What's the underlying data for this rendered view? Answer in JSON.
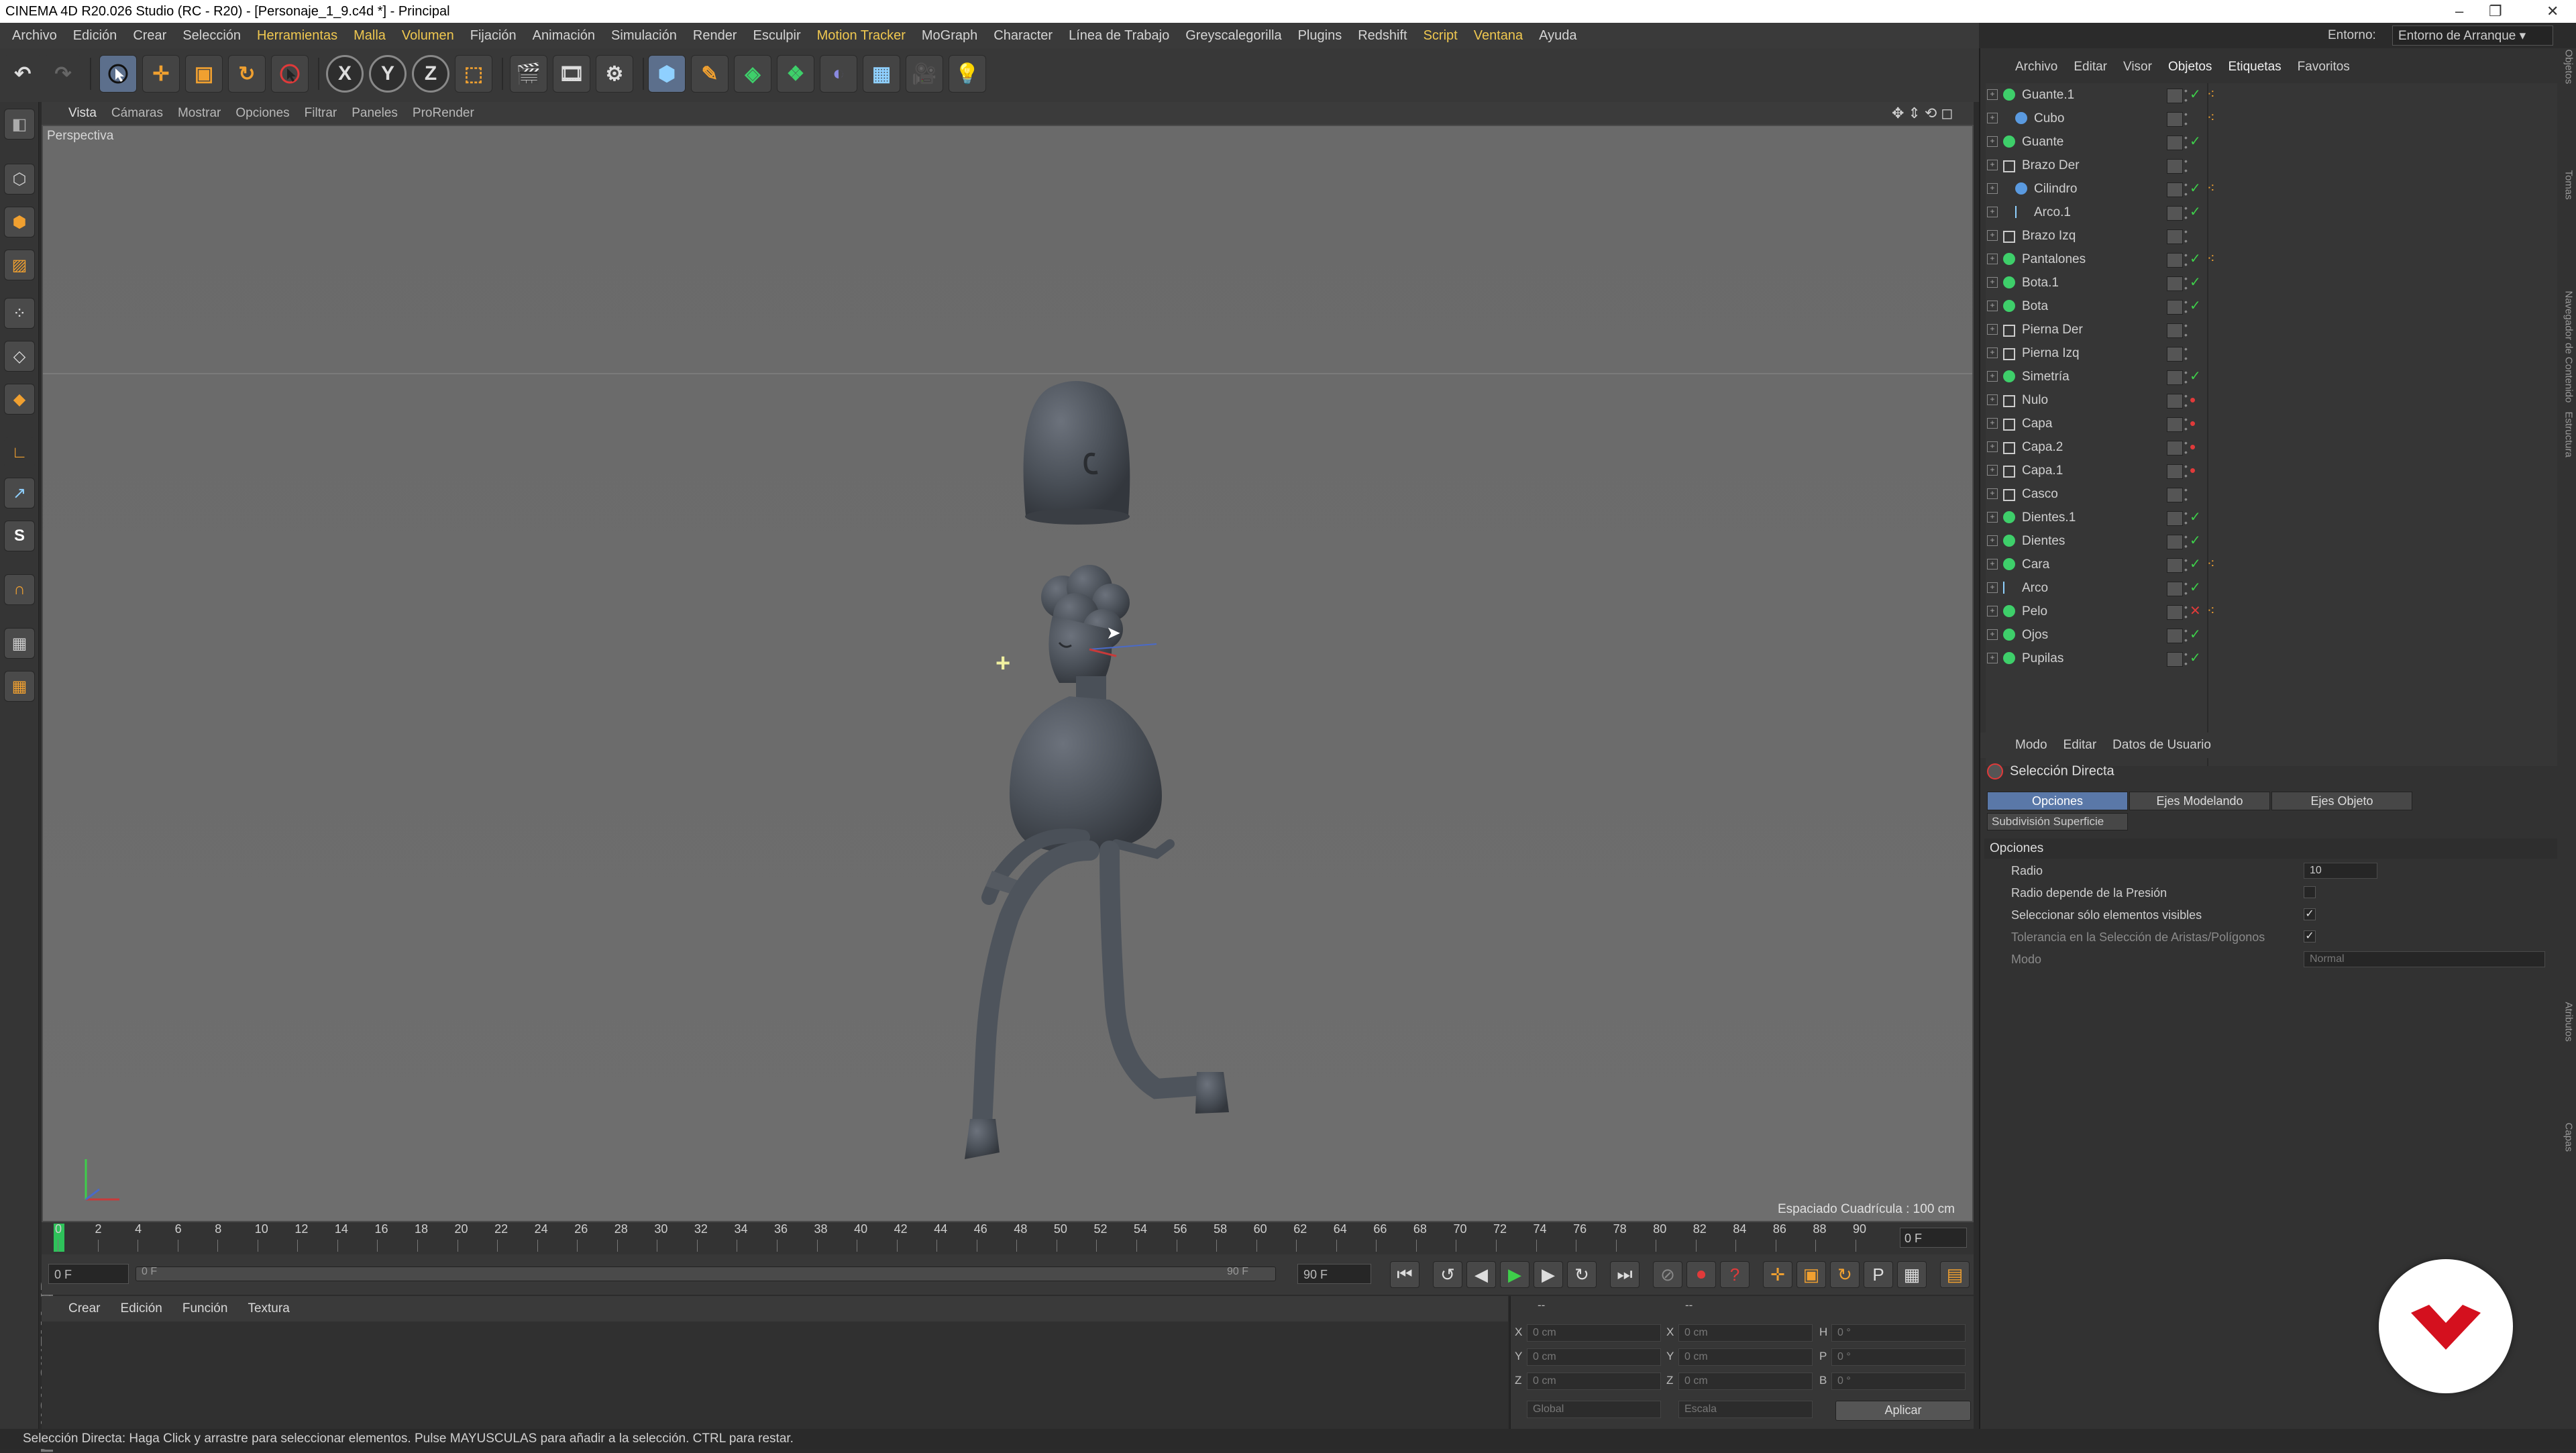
{
  "window": {
    "title": "CINEMA 4D R20.026 Studio (RC - R20) - [Personaje_1_9.c4d *] - Principal",
    "controls": [
      "–",
      "❐",
      "✕"
    ]
  },
  "menu": {
    "items": [
      "Archivo",
      "Edición",
      "Crear",
      "Selección",
      "Herramientas",
      "Malla",
      "Volumen",
      "Fijación",
      "Animación",
      "Simulación",
      "Render",
      "Esculpir",
      "Motion Tracker",
      "MoGraph",
      "Character",
      "Línea de Trabajo",
      "Greyscalegorilla",
      "Plugins",
      "Redshift",
      "Script",
      "Ventana",
      "Ayuda"
    ],
    "highlighted": [
      "Herramientas",
      "Malla",
      "Volumen",
      "Motion Tracker",
      "Script",
      "Ventana"
    ],
    "environment_label": "Entorno:",
    "environment_value": "Entorno de Arranque"
  },
  "viewport": {
    "menu": [
      "Vista",
      "Cámaras",
      "Mostrar",
      "Opciones",
      "Filtrar",
      "Paneles",
      "ProRender"
    ],
    "label": "Perspectiva",
    "grid_spacing": "Espaciado Cuadrícula : 100 cm"
  },
  "timeline": {
    "ticks": [
      "0",
      "2",
      "4",
      "6",
      "8",
      "10",
      "12",
      "14",
      "16",
      "18",
      "20",
      "22",
      "24",
      "26",
      "28",
      "30",
      "32",
      "34",
      "36",
      "38",
      "40",
      "42",
      "44",
      "46",
      "48",
      "50",
      "52",
      "54",
      "56",
      "58",
      "60",
      "62",
      "64",
      "66",
      "68",
      "70",
      "72",
      "74",
      "76",
      "78",
      "80",
      "82",
      "84",
      "86",
      "88",
      "90"
    ],
    "current_frame": "0 F",
    "end_frame": "0 F",
    "start_field": "0 F",
    "range_start": "0 F",
    "range_end": "90 F",
    "end_field": "90 F"
  },
  "material": {
    "menu": [
      "Crear",
      "Edición",
      "Función",
      "Textura"
    ]
  },
  "coords": {
    "header_left": "--",
    "header_mid": "--",
    "rows": [
      {
        "axis": "X",
        "pos": "0 cm",
        "size_axis": "X",
        "size": "0 cm",
        "rot_axis": "H",
        "rot": "0 °"
      },
      {
        "axis": "Y",
        "pos": "0 cm",
        "size_axis": "Y",
        "size": "0 cm",
        "rot_axis": "P",
        "rot": "0 °"
      },
      {
        "axis": "Z",
        "pos": "0 cm",
        "size_axis": "Z",
        "size": "0 cm",
        "rot_axis": "B",
        "rot": "0 °"
      }
    ],
    "mode1": "Global",
    "mode2": "Escala",
    "apply": "Aplicar"
  },
  "status": "Selección Directa: Haga Click y arrastre para seleccionar elementos. Pulse MAYUSCULAS para añadir a la selección. CTRL para restar.",
  "objects": {
    "menu": [
      "Archivo",
      "Editar",
      "Visor",
      "Objetos",
      "Etiquetas",
      "Favoritos"
    ],
    "items": [
      {
        "name": "Guante.1",
        "indent": 0,
        "icon": "#3ecf6a",
        "check": "green",
        "tag": true
      },
      {
        "name": "Cubo",
        "indent": 1,
        "icon": "#5a9ae0",
        "check": "none",
        "tag": true
      },
      {
        "name": "Guante",
        "indent": 0,
        "icon": "#3ecf6a",
        "check": "green",
        "tag": false
      },
      {
        "name": "Brazo Der",
        "indent": 0,
        "icon": "null",
        "check": "none",
        "tag": false
      },
      {
        "name": "Cilindro",
        "indent": 1,
        "icon": "#5a9ae0",
        "check": "green",
        "tag": true
      },
      {
        "name": "Arco.1",
        "indent": 1,
        "icon": "spline",
        "check": "green",
        "tag": false
      },
      {
        "name": "Brazo Izq",
        "indent": 0,
        "icon": "null",
        "check": "none",
        "tag": false
      },
      {
        "name": "Pantalones",
        "indent": 0,
        "icon": "#3ecf6a",
        "check": "green",
        "tag": true
      },
      {
        "name": "Bota.1",
        "indent": 0,
        "icon": "#3ecf6a",
        "check": "green",
        "tag": false
      },
      {
        "name": "Bota",
        "indent": 0,
        "icon": "#3ecf6a",
        "check": "green",
        "tag": false
      },
      {
        "name": "Pierna Der",
        "indent": 0,
        "icon": "null",
        "check": "none",
        "tag": false
      },
      {
        "name": "Pierna Izq",
        "indent": 0,
        "icon": "null",
        "check": "none",
        "tag": false
      },
      {
        "name": "Simetría",
        "indent": 0,
        "icon": "#3ecf6a",
        "check": "green",
        "tag": false
      },
      {
        "name": "Nulo",
        "indent": 0,
        "icon": "null",
        "check": "red-dot",
        "tag": false
      },
      {
        "name": "Capa",
        "indent": 0,
        "icon": "null",
        "check": "red-dot",
        "tag": false
      },
      {
        "name": "Capa.2",
        "indent": 0,
        "icon": "null",
        "check": "red-dot",
        "tag": false
      },
      {
        "name": "Capa.1",
        "indent": 0,
        "icon": "null",
        "check": "red-dot",
        "tag": false
      },
      {
        "name": "Casco",
        "indent": 0,
        "icon": "null",
        "check": "none",
        "tag": false
      },
      {
        "name": "Dientes.1",
        "indent": 0,
        "icon": "#3ecf6a",
        "check": "green",
        "tag": false
      },
      {
        "name": "Dientes",
        "indent": 0,
        "icon": "#3ecf6a",
        "check": "green",
        "tag": false
      },
      {
        "name": "Cara",
        "indent": 0,
        "icon": "#3ecf6a",
        "check": "green",
        "tag": true
      },
      {
        "name": "Arco",
        "indent": 0,
        "icon": "spline",
        "check": "green",
        "tag": false
      },
      {
        "name": "Pelo",
        "indent": 0,
        "icon": "#3ecf6a",
        "check": "red",
        "tag": true
      },
      {
        "name": "Ojos",
        "indent": 0,
        "icon": "#3ecf6a",
        "check": "green",
        "tag": false
      },
      {
        "name": "Pupilas",
        "indent": 0,
        "icon": "#3ecf6a",
        "check": "green",
        "tag": false
      }
    ]
  },
  "attributes": {
    "menu": [
      "Modo",
      "Editar",
      "Datos de Usuario"
    ],
    "title": "Selección Directa",
    "tabs": [
      "Opciones",
      "Ejes Modelando",
      "Ejes Objeto"
    ],
    "subtab": "Subdivisión Superficie",
    "section": "Opciones",
    "fields": [
      {
        "label": "Radio",
        "value": "10",
        "type": "number",
        "dim": false
      },
      {
        "label": "Radio depende de la Presión",
        "value": "",
        "type": "checkbox",
        "dim": false
      },
      {
        "label": "Seleccionar sólo elementos visibles",
        "value": "✓",
        "type": "checkbox",
        "dim": false
      },
      {
        "label": "Tolerancia en la Selección de Aristas/Polígonos",
        "value": "✓",
        "type": "checkbox",
        "dim": true
      },
      {
        "label": "Modo",
        "value": "Normal",
        "type": "select",
        "dim": true
      }
    ]
  },
  "side_tabs": [
    "Objetos",
    "Tomas",
    "Navegador de Contenido",
    "Estructura",
    "Atributos",
    "Capas"
  ],
  "colors": {
    "accent": "#5a78a8",
    "check_green": "#3ecf4a",
    "check_red": "#e03a3a",
    "tool_orange": "#f0a030",
    "logo_red": "#d4101e"
  }
}
